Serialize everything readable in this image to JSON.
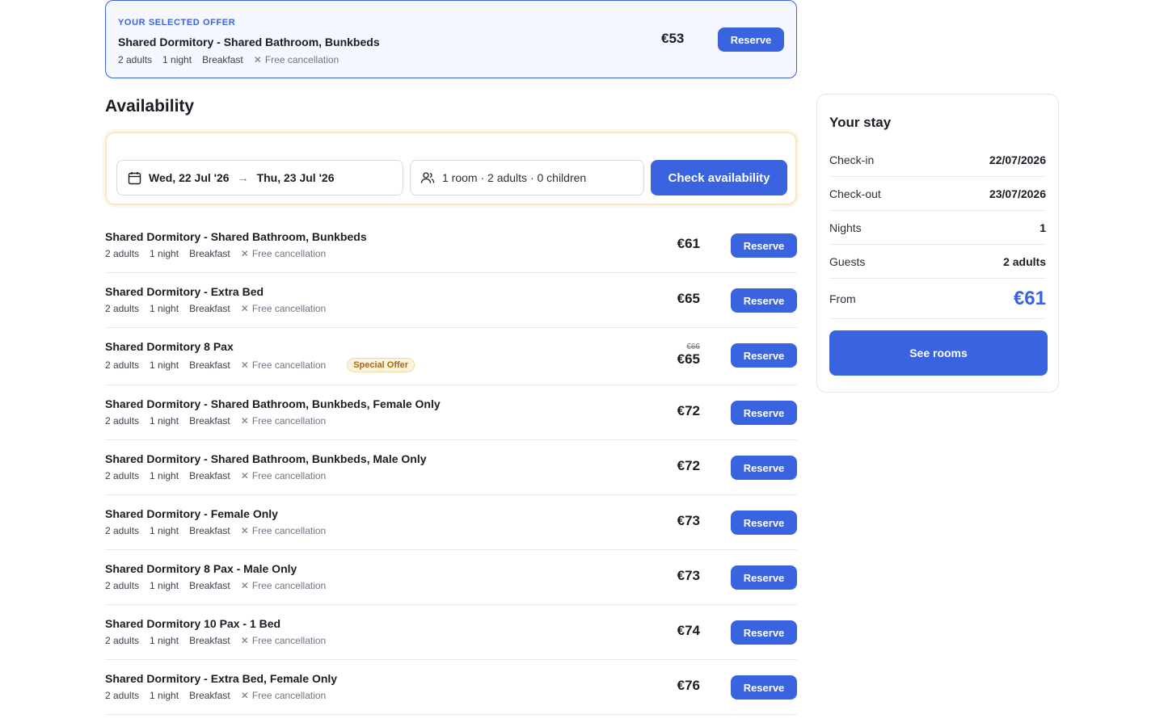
{
  "selected_offer": {
    "label": "YOUR SELECTED OFFER",
    "title": "Shared Dormitory - Shared Bathroom, Bunkbeds",
    "adults": "2 adults",
    "nights": "1 night",
    "board": "Breakfast",
    "cancellation": "Free cancellation",
    "price": "€53",
    "reserve_label": "Reserve"
  },
  "availability": {
    "title": "Availability",
    "date_from": "Wed, 22 Jul '26",
    "date_to": "Thu, 23 Jul '26",
    "guests": "1 room · 2 adults · 0 children",
    "check_label": "Check availability"
  },
  "rooms": [
    {
      "name": "Shared Dormitory - Shared Bathroom, Bunkbeds",
      "adults": "2 adults",
      "nights": "1 night",
      "board": "Breakfast",
      "cancellation": "Free cancellation",
      "price": "€61",
      "reserve": "Reserve"
    },
    {
      "name": "Shared Dormitory - Extra Bed",
      "adults": "2 adults",
      "nights": "1 night",
      "board": "Breakfast",
      "cancellation": "Free cancellation",
      "price": "€65",
      "reserve": "Reserve"
    },
    {
      "name": "Shared Dormitory 8 Pax",
      "adults": "2 adults",
      "nights": "1 night",
      "board": "Breakfast",
      "cancellation": "Free cancellation",
      "badge": "Special Offer",
      "old_price": "€66",
      "price": "€65",
      "reserve": "Reserve"
    },
    {
      "name": "Shared Dormitory - Shared Bathroom, Bunkbeds, Female Only",
      "adults": "2 adults",
      "nights": "1 night",
      "board": "Breakfast",
      "cancellation": "Free cancellation",
      "price": "€72",
      "reserve": "Reserve"
    },
    {
      "name": "Shared Dormitory - Shared Bathroom, Bunkbeds, Male Only",
      "adults": "2 adults",
      "nights": "1 night",
      "board": "Breakfast",
      "cancellation": "Free cancellation",
      "price": "€72",
      "reserve": "Reserve"
    },
    {
      "name": "Shared Dormitory - Female Only",
      "adults": "2 adults",
      "nights": "1 night",
      "board": "Breakfast",
      "cancellation": "Free cancellation",
      "price": "€73",
      "reserve": "Reserve"
    },
    {
      "name": "Shared Dormitory 8 Pax - Male Only",
      "adults": "2 adults",
      "nights": "1 night",
      "board": "Breakfast",
      "cancellation": "Free cancellation",
      "price": "€73",
      "reserve": "Reserve"
    },
    {
      "name": "Shared Dormitory 10 Pax - 1 Bed",
      "adults": "2 adults",
      "nights": "1 night",
      "board": "Breakfast",
      "cancellation": "Free cancellation",
      "price": "€74",
      "reserve": "Reserve"
    },
    {
      "name": "Shared Dormitory - Extra Bed, Female Only",
      "adults": "2 adults",
      "nights": "1 night",
      "board": "Breakfast",
      "cancellation": "Free cancellation",
      "price": "€76",
      "reserve": "Reserve"
    }
  ],
  "stay": {
    "title": "Your stay",
    "checkin_label": "Check-in",
    "checkin_value": "22/07/2026",
    "checkout_label": "Check-out",
    "checkout_value": "23/07/2026",
    "nights_label": "Nights",
    "nights_value": "1",
    "guests_label": "Guests",
    "guests_value": "2 adults",
    "from_label": "From",
    "from_value": "€61",
    "see_rooms_label": "See rooms"
  },
  "icons": {
    "calendar": "calendar-icon",
    "guests": "users-icon",
    "arrow": "arrow-right-icon",
    "cancel": "x-icon"
  },
  "colors": {
    "accent": "#3a63e0",
    "badge_bg": "#fdf3dc",
    "badge_text": "#a86a12"
  }
}
